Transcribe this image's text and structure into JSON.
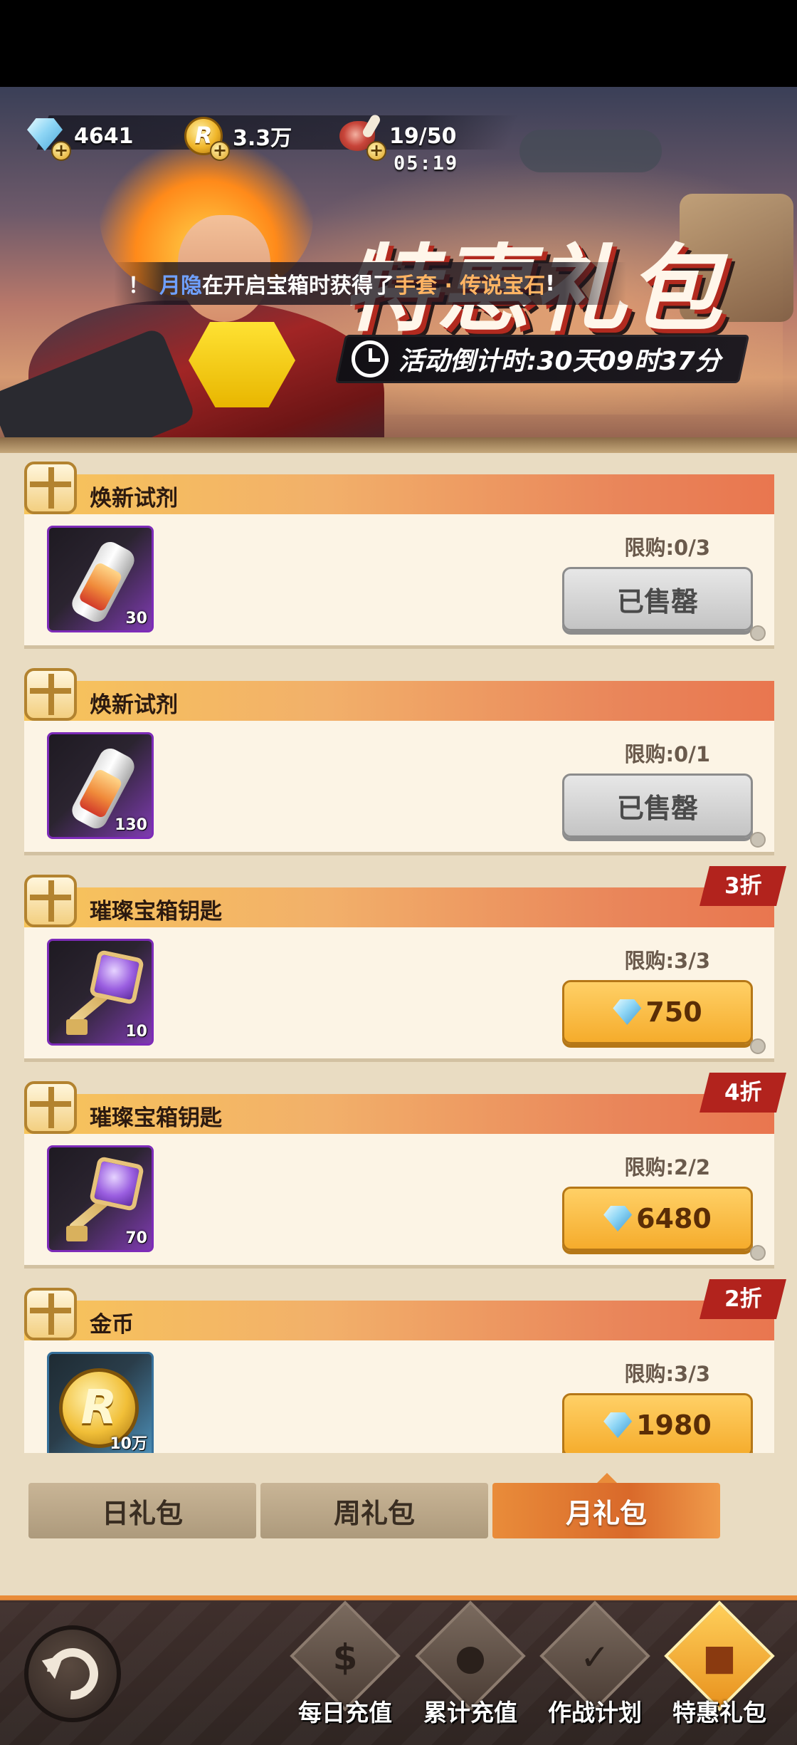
{
  "resources": {
    "gems": "4641",
    "coins": "3.3万",
    "energy": "19/50",
    "energy_timer": "05:19"
  },
  "banner": {
    "title": "特惠礼包",
    "marquee": {
      "prefix": "！",
      "player": "月隐",
      "text": "在开启宝箱时获得了",
      "item": "手套 · 传说宝石",
      "suffix": "!"
    },
    "countdown": "活动倒计时:30天09时37分"
  },
  "packs": [
    {
      "name": "焕新试剂",
      "count": "30",
      "limit": "限购:0/3",
      "button": "已售罄",
      "sold_out": true,
      "discount": "",
      "icon": "potion-icon"
    },
    {
      "name": "焕新试剂",
      "count": "130",
      "limit": "限购:0/1",
      "button": "已售罄",
      "sold_out": true,
      "discount": "",
      "icon": "potion-icon"
    },
    {
      "name": "璀璨宝箱钥匙",
      "count": "10",
      "limit": "限购:3/3",
      "button": "750",
      "sold_out": false,
      "discount": "3折",
      "icon": "key-icon"
    },
    {
      "name": "璀璨宝箱钥匙",
      "count": "70",
      "limit": "限购:2/2",
      "button": "6480",
      "sold_out": false,
      "discount": "4折",
      "icon": "key-icon"
    },
    {
      "name": "金币",
      "count": "10万",
      "limit": "限购:3/3",
      "button": "1980",
      "sold_out": false,
      "discount": "2折",
      "icon": "gold-coin-icon"
    }
  ],
  "tabs": [
    {
      "label": "日礼包",
      "active": false
    },
    {
      "label": "周礼包",
      "active": false
    },
    {
      "label": "月礼包",
      "active": true
    }
  ],
  "nav": [
    {
      "label": "每日充值",
      "icon": "dollar-plus-icon"
    },
    {
      "label": "累计充值",
      "icon": "piggy-bank-icon"
    },
    {
      "label": "作战计划",
      "icon": "calendar-check-icon"
    },
    {
      "label": "特惠礼包",
      "icon": "gift-icon"
    }
  ],
  "colors": {
    "accent_orange": "#e98c3a",
    "discount_red": "#b2231d",
    "price_button": "#f5ac2c",
    "sold_out_button": "#c4c4c4"
  }
}
